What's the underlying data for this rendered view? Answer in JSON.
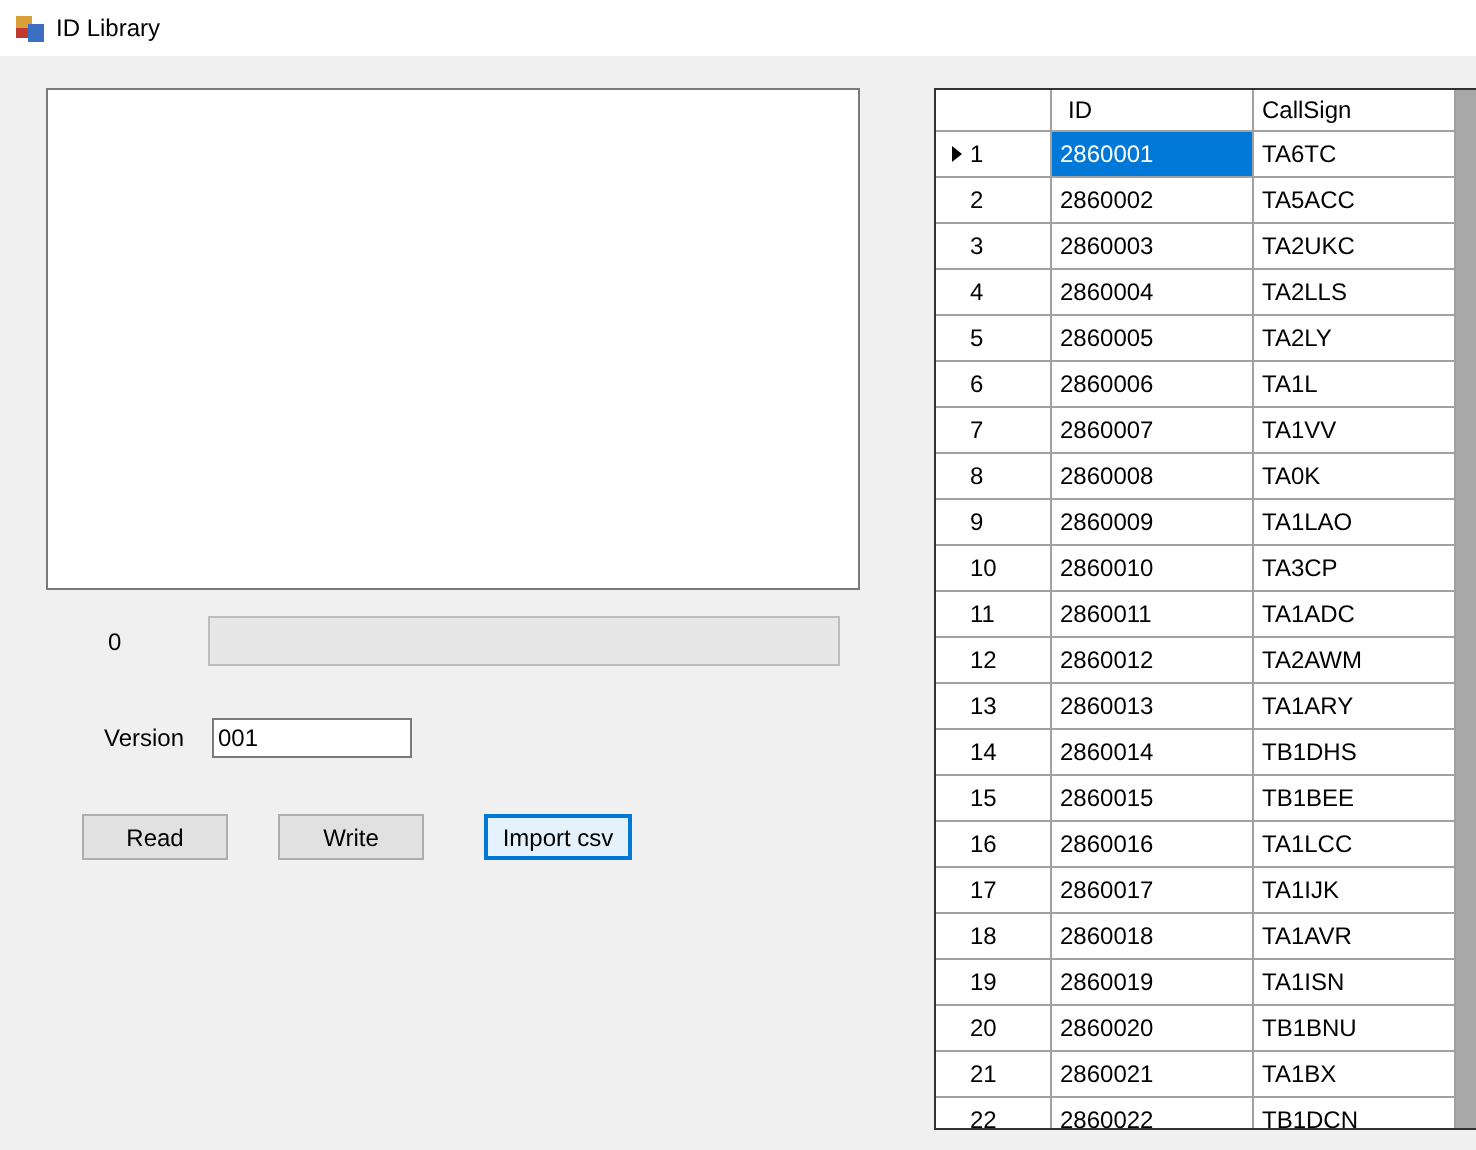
{
  "window": {
    "title": "ID Library"
  },
  "progress": {
    "label": "0",
    "level": 0
  },
  "version": {
    "label": "Version",
    "value": "001"
  },
  "buttons": [
    {
      "label": "Read",
      "focused": false
    },
    {
      "label": "Write",
      "focused": false
    },
    {
      "label": "Import csv",
      "focused": true
    }
  ],
  "table": {
    "columns": [
      "ID",
      "CallSign"
    ],
    "rows": [
      {
        "number": "1",
        "id": "2860001",
        "callsign": "TA6TC",
        "selected": true
      },
      {
        "number": "2",
        "id": "2860002",
        "callsign": "TA5ACC",
        "selected": false
      },
      {
        "number": "3",
        "id": "2860003",
        "callsign": "TA2UKC",
        "selected": false
      },
      {
        "number": "4",
        "id": "2860004",
        "callsign": "TA2LLS",
        "selected": false
      },
      {
        "number": "5",
        "id": "2860005",
        "callsign": "TA2LY",
        "selected": false
      },
      {
        "number": "6",
        "id": "2860006",
        "callsign": "TA1L",
        "selected": false
      },
      {
        "number": "7",
        "id": "2860007",
        "callsign": "TA1VV",
        "selected": false
      },
      {
        "number": "8",
        "id": "2860008",
        "callsign": "TA0K",
        "selected": false
      },
      {
        "number": "9",
        "id": "2860009",
        "callsign": "TA1LAO",
        "selected": false
      },
      {
        "number": "10",
        "id": "2860010",
        "callsign": "TA3CP",
        "selected": false
      },
      {
        "number": "11",
        "id": "2860011",
        "callsign": "TA1ADC",
        "selected": false
      },
      {
        "number": "12",
        "id": "2860012",
        "callsign": "TA2AWM",
        "selected": false
      },
      {
        "number": "13",
        "id": "2860013",
        "callsign": "TA1ARY",
        "selected": false
      },
      {
        "number": "14",
        "id": "2860014",
        "callsign": "TB1DHS",
        "selected": false
      },
      {
        "number": "15",
        "id": "2860015",
        "callsign": "TB1BEE",
        "selected": false
      },
      {
        "number": "16",
        "id": "2860016",
        "callsign": "TA1LCC",
        "selected": false
      },
      {
        "number": "17",
        "id": "2860017",
        "callsign": "TA1IJK",
        "selected": false
      },
      {
        "number": "18",
        "id": "2860018",
        "callsign": "TA1AVR",
        "selected": false
      },
      {
        "number": "19",
        "id": "2860019",
        "callsign": "TA1ISN",
        "selected": false
      },
      {
        "number": "20",
        "id": "2860020",
        "callsign": "TB1BNU",
        "selected": false
      },
      {
        "number": "21",
        "id": "2860021",
        "callsign": "TA1BX",
        "selected": false
      },
      {
        "number": "22",
        "id": "2860022",
        "callsign": "TB1DCN",
        "selected": false
      }
    ]
  }
}
